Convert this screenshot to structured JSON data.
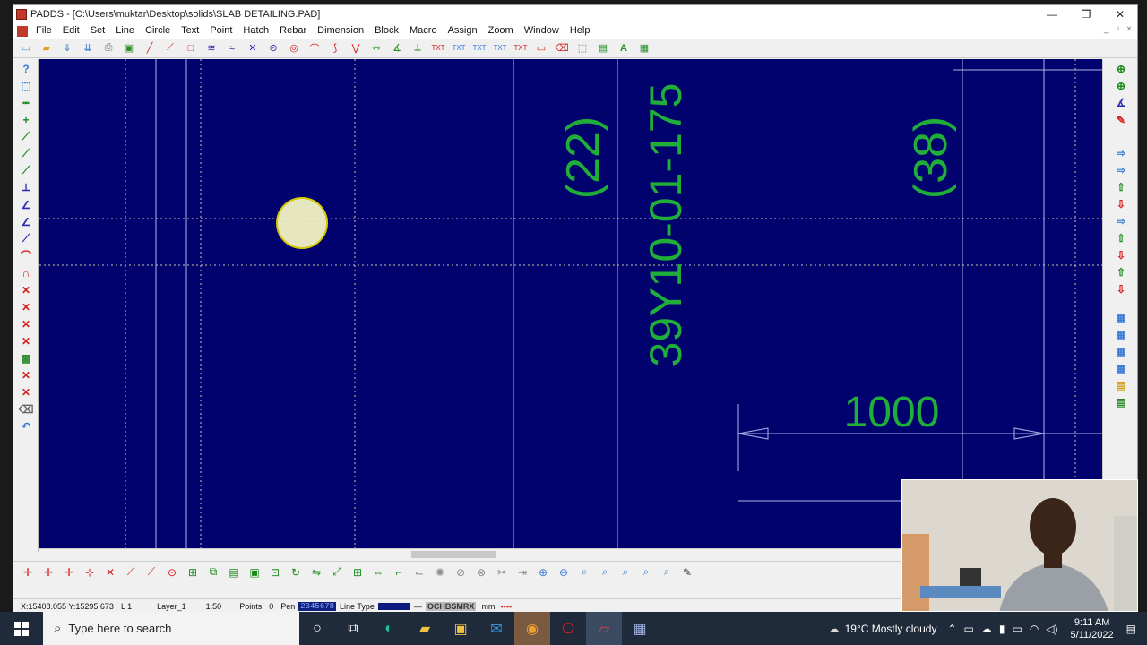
{
  "window": {
    "title": "PADDS - [C:\\Users\\muktar\\Desktop\\solids\\SLAB DETAILING.PAD]",
    "controls": {
      "minimize": "—",
      "restore": "❐",
      "close": "✕"
    }
  },
  "menubar": {
    "items": [
      "File",
      "Edit",
      "Set",
      "Line",
      "Circle",
      "Text",
      "Point",
      "Hatch",
      "Rebar",
      "Dimension",
      "Block",
      "Macro",
      "Assign",
      "Zoom",
      "Window",
      "Help"
    ]
  },
  "drawing": {
    "background": "#02026e",
    "line_color": "#6a8fd8",
    "text_color": "#1fae3a",
    "labels": {
      "bar_mark_22": "(22)",
      "bar_mark_38": "(38)",
      "bar_callout": "39Y10-01-175",
      "dimension": "1000"
    }
  },
  "statusbar": {
    "coords": "X:15408.055 Y:15295.673",
    "level": "L 1",
    "layer": "Layer_1",
    "scale": "1:50",
    "points_label": "Points",
    "points_value": "0",
    "pen_label": "Pen",
    "pen_values": "2345678",
    "linetype_label": "Line Type",
    "modes": "OCHBSMRX",
    "units": "mm"
  },
  "taskbar": {
    "search_placeholder": "Type here to search",
    "weather": "19°C  Mostly cloudy",
    "time": "9:11 AM",
    "date": "5/11/2022"
  }
}
